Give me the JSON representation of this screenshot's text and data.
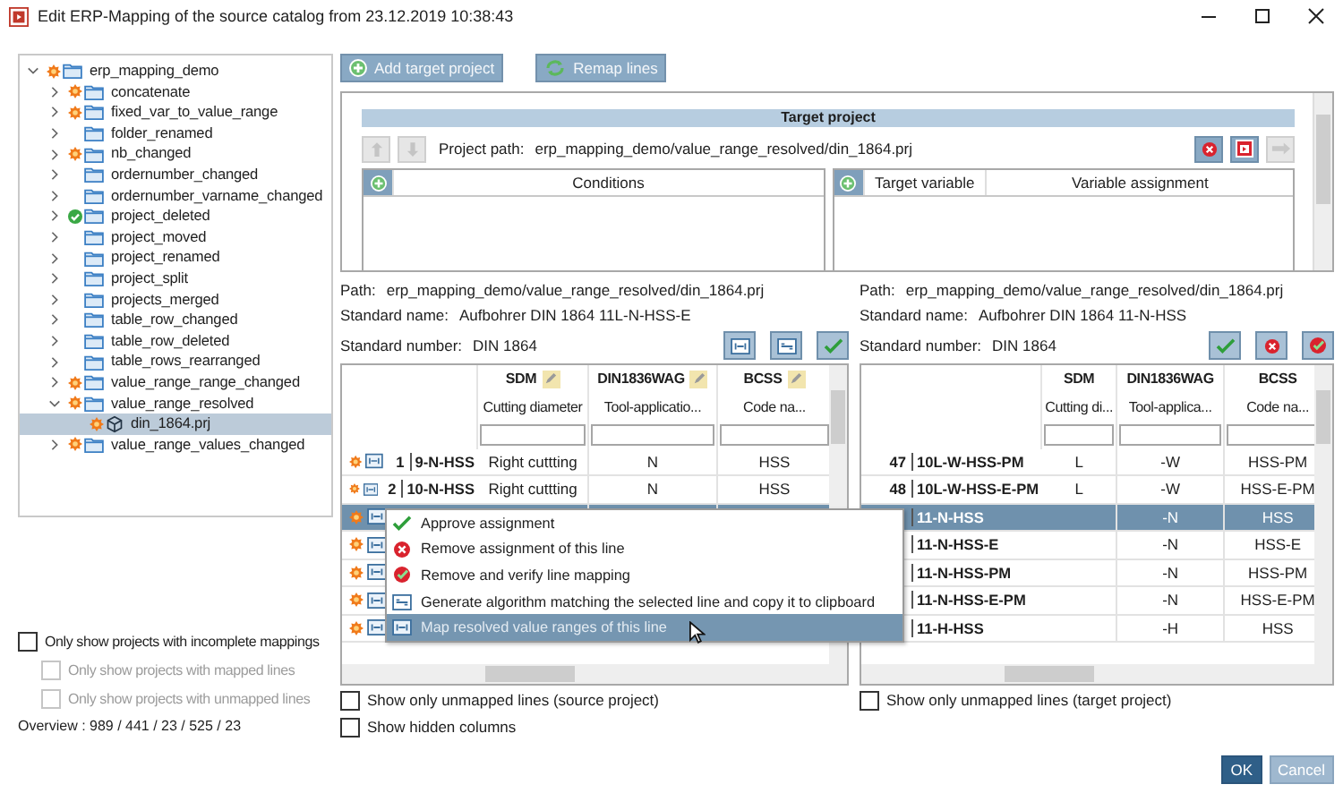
{
  "window": {
    "title": "Edit ERP-Mapping of the source catalog from 23.12.2019 10:38:43"
  },
  "tree": {
    "items": [
      {
        "label": "erp_mapping_demo",
        "kind": "folder",
        "warning": true,
        "approved": false,
        "expanded": true,
        "selected": false,
        "children": [
          {
            "label": "concatenate",
            "kind": "folder",
            "warning": true,
            "approved": false,
            "expanded": false,
            "selected": false
          },
          {
            "label": "fixed_var_to_value_range",
            "kind": "folder",
            "warning": true,
            "approved": false,
            "expanded": false,
            "selected": false
          },
          {
            "label": "folder_renamed",
            "kind": "folder",
            "warning": false,
            "approved": false,
            "expanded": false,
            "selected": false
          },
          {
            "label": "nb_changed",
            "kind": "folder",
            "warning": true,
            "approved": false,
            "expanded": false,
            "selected": false
          },
          {
            "label": "ordernumber_changed",
            "kind": "folder",
            "warning": false,
            "approved": false,
            "expanded": false,
            "selected": false
          },
          {
            "label": "ordernumber_varname_changed",
            "kind": "folder",
            "warning": false,
            "approved": false,
            "expanded": false,
            "selected": false
          },
          {
            "label": "project_deleted",
            "kind": "folder",
            "warning": false,
            "approved": true,
            "expanded": false,
            "selected": false
          },
          {
            "label": "project_moved",
            "kind": "folder",
            "warning": false,
            "approved": false,
            "expanded": false,
            "selected": false
          },
          {
            "label": "project_renamed",
            "kind": "folder",
            "warning": false,
            "approved": false,
            "expanded": false,
            "selected": false
          },
          {
            "label": "project_split",
            "kind": "folder",
            "warning": false,
            "approved": false,
            "expanded": false,
            "selected": false
          },
          {
            "label": "projects_merged",
            "kind": "folder",
            "warning": false,
            "approved": false,
            "expanded": false,
            "selected": false
          },
          {
            "label": "table_row_changed",
            "kind": "folder",
            "warning": false,
            "approved": false,
            "expanded": false,
            "selected": false
          },
          {
            "label": "table_row_deleted",
            "kind": "folder",
            "warning": false,
            "approved": false,
            "expanded": false,
            "selected": false
          },
          {
            "label": "table_rows_rearranged",
            "kind": "folder",
            "warning": false,
            "approved": false,
            "expanded": false,
            "selected": false
          },
          {
            "label": "value_range_range_changed",
            "kind": "folder",
            "warning": true,
            "approved": false,
            "expanded": false,
            "selected": false
          },
          {
            "label": "value_range_resolved",
            "kind": "folder",
            "warning": true,
            "approved": false,
            "expanded": true,
            "selected": false,
            "children": [
              {
                "label": "din_1864.prj",
                "kind": "file",
                "warning": true,
                "approved": false,
                "selected": true
              }
            ]
          },
          {
            "label": "value_range_values_changed",
            "kind": "folder",
            "warning": true,
            "approved": false,
            "expanded": false,
            "selected": false
          }
        ]
      }
    ]
  },
  "filters": [
    {
      "label": "Only show projects with incomplete mappings",
      "checked": false,
      "disabled": false,
      "children": [
        {
          "label": "Only show projects with mapped lines",
          "checked": false,
          "disabled": true
        },
        {
          "label": "Only show projects with unmapped lines",
          "checked": false,
          "disabled": true
        }
      ]
    }
  ],
  "overview": "Overview : 989 / 441 / 23 / 525 / 23",
  "toolbar": [
    {
      "label": "Add target project",
      "kind": "add"
    },
    {
      "label": "Remap lines",
      "kind": "remap"
    }
  ],
  "target_project": {
    "title": "Target project",
    "path_label": "Project path:",
    "path": "erp_mapping_demo/value_range_resolved/din_1864.prj",
    "nav_buttons": [
      {
        "kind": "up",
        "disabled": true
      },
      {
        "kind": "down",
        "disabled": true
      }
    ],
    "actions": [
      {
        "kind": "remove",
        "disabled": false
      },
      {
        "kind": "open",
        "disabled": false
      },
      {
        "kind": "forward",
        "disabled": true
      }
    ],
    "conditions": {
      "columns": [
        "Conditions"
      ]
    },
    "assignments": {
      "columns": [
        "Target variable",
        "Variable assignment"
      ]
    }
  },
  "panes": [
    {
      "kind": "source",
      "info": [
        {
          "label": "Path:",
          "value": "erp_mapping_demo/value_range_resolved/din_1864.prj"
        },
        {
          "label": "Standard name:",
          "value": "Aufbohrer DIN 1864 11L-N-HSS-E"
        },
        {
          "label": "Standard number:",
          "value": "DIN 1864"
        }
      ],
      "tools": [
        {
          "kind": "map"
        },
        {
          "kind": "algorithm"
        },
        {
          "kind": "approve"
        }
      ],
      "columns": [
        {
          "name": "SDM",
          "description": "Cutting diameter",
          "editable": true
        },
        {
          "name": "DIN1836WAG",
          "description": "Tool-applicatio...",
          "editable": true
        },
        {
          "name": "BCSS",
          "description": "Code na...",
          "editable": true
        }
      ],
      "rows": [
        {
          "warning": true,
          "number": "1",
          "code": "9-N-HSS",
          "cells": [
            "Right cuttting",
            "N",
            "HSS"
          ],
          "selected": false
        },
        {
          "warning": true,
          "number": "2",
          "code": "10-N-HSS",
          "cells": [
            "Right cuttting",
            "N",
            "HSS"
          ],
          "selected": false
        },
        {
          "warning": true,
          "selected": true
        },
        {
          "warning": true,
          "selected": false
        },
        {
          "warning": true,
          "selected": false
        },
        {
          "warning": true,
          "selected": false
        },
        {
          "warning": true,
          "selected": false
        }
      ],
      "checks": [
        {
          "label": "Show only unmapped lines (source project)",
          "checked": false
        },
        {
          "label": "Show hidden columns",
          "checked": false
        }
      ]
    },
    {
      "kind": "target",
      "info": [
        {
          "label": "Path:",
          "value": "erp_mapping_demo/value_range_resolved/din_1864.prj"
        },
        {
          "label": "Standard name:",
          "value": "Aufbohrer DIN 1864 11-N-HSS"
        },
        {
          "label": "Standard number:",
          "value": "DIN 1864"
        }
      ],
      "tools": [
        {
          "kind": "approve"
        },
        {
          "kind": "remove"
        },
        {
          "kind": "verify"
        }
      ],
      "columns": [
        {
          "name": "SDM",
          "description": "Cutting di...",
          "editable": false
        },
        {
          "name": "DIN1836WAG",
          "description": "Tool-applica...",
          "editable": false
        },
        {
          "name": "BCSS",
          "description": "Code na...",
          "editable": false
        }
      ],
      "rows": [
        {
          "number": "47",
          "code": "10L-W-HSS-PM",
          "cells": [
            "L",
            "-W",
            "HSS-PM"
          ],
          "selected": false
        },
        {
          "number": "48",
          "code": "10L-W-HSS-E-PM",
          "cells": [
            "L",
            "-W",
            "HSS-E-PM"
          ],
          "selected": false
        },
        {
          "code": "11-N-HSS",
          "cells": [
            null,
            "-N",
            "HSS"
          ],
          "selected": true
        },
        {
          "code": "11-N-HSS-E",
          "cells": [
            null,
            "-N",
            "HSS-E"
          ],
          "selected": false
        },
        {
          "code": "11-N-HSS-PM",
          "cells": [
            null,
            "-N",
            "HSS-PM"
          ],
          "selected": false
        },
        {
          "code": "11-N-HSS-E-PM",
          "cells": [
            null,
            "-N",
            "HSS-E-PM"
          ],
          "selected": false
        },
        {
          "code": "11-H-HSS",
          "cells": [
            null,
            "-H",
            "HSS"
          ],
          "selected": false
        }
      ],
      "checks": [
        {
          "label": "Show only unmapped lines (target project)",
          "checked": false
        }
      ]
    }
  ],
  "context_menu": {
    "items": [
      {
        "kind": "approve",
        "label": "Approve assignment",
        "selected": false
      },
      {
        "kind": "remove",
        "label": "Remove assignment of this line",
        "selected": false
      },
      {
        "kind": "verify",
        "label": "Remove and verify line mapping",
        "selected": false
      },
      {
        "kind": "algorithm",
        "label": "Generate algorithm matching the selected line and copy it to clipboard",
        "selected": false
      },
      {
        "kind": "map",
        "label": "Map resolved value ranges of this line",
        "selected": true
      }
    ]
  },
  "buttons": [
    {
      "label": "OK",
      "kind": "primary"
    },
    {
      "label": "Cancel",
      "kind": "secondary"
    }
  ]
}
